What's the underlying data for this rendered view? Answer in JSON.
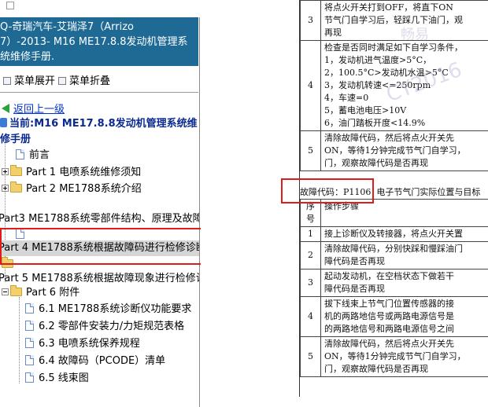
{
  "window": {
    "title_lines": [
      "Q-奇瑞汽车-艾瑞泽7（Arrizo",
      "7）-2013- M16 ME17.8.8发动机管理系",
      "统维修手册."
    ]
  },
  "toolbar": {
    "expand_label": "菜单展开",
    "collapse_label": "菜单折叠"
  },
  "tree": {
    "back_label": "返回上一级",
    "current_line1": "当前:M16 ME17.8.8发动机管理系统维",
    "current_line2": "修手册",
    "items": [
      {
        "label": "前言"
      },
      {
        "label": "Part 1 电喷系统维修须知"
      },
      {
        "label": "Part 2 ME1788系统介绍"
      },
      {
        "label": "Part3 ME1788系统零部件结构、原理及故障"
      },
      {
        "label": "Part 4 ME1788系统根据故障码进行检修诊断"
      },
      {
        "label": "Part 5 ME1788系统根据故障现象进行检修诊"
      },
      {
        "label": "Part 6 附件"
      }
    ],
    "children": [
      {
        "label": "6.1 ME1788系统诊断仪功能要求"
      },
      {
        "label": "6.2 零部件安装力/力矩规范表格"
      },
      {
        "label": "6.3 电喷系统保养规程"
      },
      {
        "label": "6.4 故障码（PCODE）清单"
      },
      {
        "label": "6.5 线束图"
      }
    ]
  },
  "document": {
    "table1": [
      {
        "num": "3",
        "lines": [
          "将点火开关打到OFF，将直下ON",
          "节气门自学习后，轻踩几下油门，观",
          "再现"
        ]
      },
      {
        "num": "4",
        "lines": [
          "检查是否同时满足如下自学习条件，",
          "1，发动机进气温度>5°C，",
          "2，100.5°C>发动机水温>5°C",
          "3，发动机转速<=250rpm",
          "4，车速=0",
          "5，蓄电池电压>10V",
          "6，油门踏板开度<14.9%"
        ]
      },
      {
        "num": "5",
        "lines": [
          "清除故障代码，然后将点火开关先",
          "ON，等待1分钟完成节气门自学习，",
          "门，观察故障代码是否再现"
        ]
      }
    ],
    "fault_code_label": "故障代码：P1106",
    "fault_code_desc": "电子节气门实际位置与目标",
    "table2": [
      {
        "num": "序号",
        "lines": [
          "操作步骤"
        ]
      },
      {
        "num": "1",
        "lines": [
          "接上诊断仪及转接器，将点火开关置"
        ]
      },
      {
        "num": "2",
        "lines": [
          "清除故障代码，分别快踩和慢踩油门",
          "障代码是否再现"
        ]
      },
      {
        "num": "3",
        "lines": [
          "起动发动机，在空档状态下做若干",
          "障代码是否再现"
        ]
      },
      {
        "num": "4",
        "lines": [
          "拔下线束上节气门位置传感器的接",
          "机的两路地信号或两路电源信号是",
          "的两路地信号和两路电源信号之间"
        ]
      },
      {
        "num": "5",
        "lines": [
          "清除故障代码，然后将点火开关先",
          "ON，等待1分钟完成节气门自学习，",
          "门，观察故障代码是否再现"
        ]
      }
    ],
    "watermark_text": "CY2016",
    "watermark_cn": "畅易"
  },
  "colors": {
    "title_bg": "#1f6a95",
    "highlight_red": "#e01b1b",
    "link_blue": "#0033cc",
    "current_blue": "#0b2a8f"
  }
}
